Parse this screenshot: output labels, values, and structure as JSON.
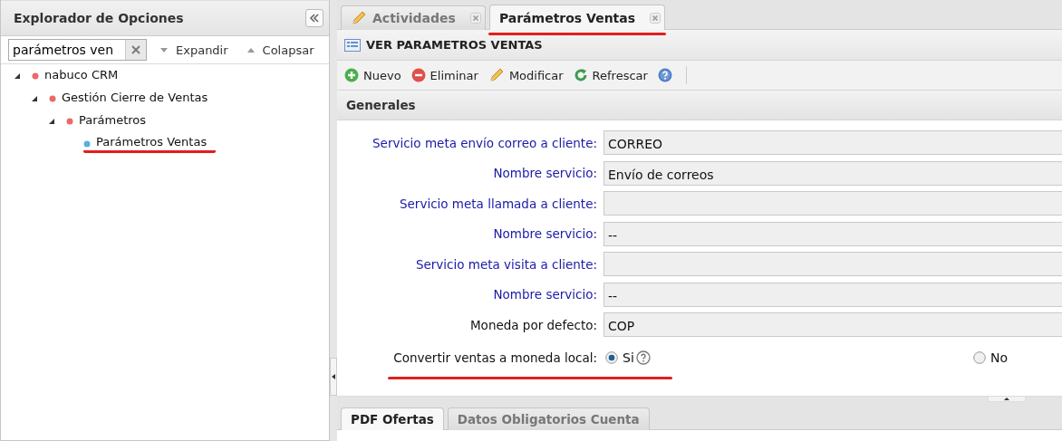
{
  "explorer": {
    "title": "Explorador de Opciones",
    "search": {
      "value": "parámetros ven"
    },
    "actions": [
      {
        "label": "Expandir",
        "kind": "expand"
      },
      {
        "label": "Colapsar",
        "kind": "collapse"
      }
    ],
    "tree": [
      {
        "label": "nabuco CRM",
        "color": "#e86a6a",
        "expanded": true,
        "underlined": false,
        "children": [
          {
            "label": "Gestión Cierre de Ventas",
            "color": "#e86a6a",
            "expanded": true,
            "underlined": false,
            "children": [
              {
                "label": "Parámetros",
                "color": "#e86a6a",
                "expanded": true,
                "underlined": false,
                "children": [
                  {
                    "label": "Parámetros Ventas",
                    "color": "#5aaee6",
                    "expanded": false,
                    "underlined": true
                  }
                ]
              }
            ]
          }
        ]
      }
    ]
  },
  "tabs": [
    {
      "label": "Actividades",
      "selected": false,
      "kind": "edit",
      "underlined": false
    },
    {
      "label": "Parámetros Ventas",
      "selected": true,
      "kind": "plain",
      "underlined": true
    }
  ],
  "panel": {
    "title": "VER PARAMETROS VENTAS",
    "toolbar": [
      {
        "label": "Nuevo",
        "kind": "add"
      },
      {
        "label": "Eliminar",
        "kind": "remove"
      },
      {
        "label": "Modificar",
        "kind": "edit"
      },
      {
        "label": "Refrescar",
        "kind": "refresh"
      },
      {
        "kind": "help"
      }
    ],
    "section": "Generales",
    "fields": [
      {
        "label": "Servicio meta envío correo a cliente:",
        "kind": "link",
        "value": "CORREO"
      },
      {
        "label": "Nombre servicio:",
        "kind": "link",
        "value": "Envío de correos"
      },
      {
        "label": "Servicio meta llamada a cliente:",
        "kind": "link"
      },
      {
        "label": "Nombre servicio:",
        "kind": "link",
        "value": "--"
      },
      {
        "label": "Servicio meta visita a cliente:",
        "kind": "link"
      },
      {
        "label": "Nombre servicio:",
        "kind": "link",
        "value": "--"
      },
      {
        "label": "Moneda por defecto:",
        "kind": "plain",
        "value": "COP"
      }
    ],
    "radio": {
      "label": "Convertir ventas a moneda local:",
      "underlined": true,
      "options": [
        {
          "label": "Si",
          "selected": true,
          "help": true
        },
        {
          "label": "No",
          "selected": false,
          "help": false
        }
      ]
    },
    "bottom_tabs": [
      {
        "label": "PDF Ofertas",
        "selected": true
      },
      {
        "label": "Datos Obligatorios Cuenta",
        "selected": false
      }
    ]
  }
}
